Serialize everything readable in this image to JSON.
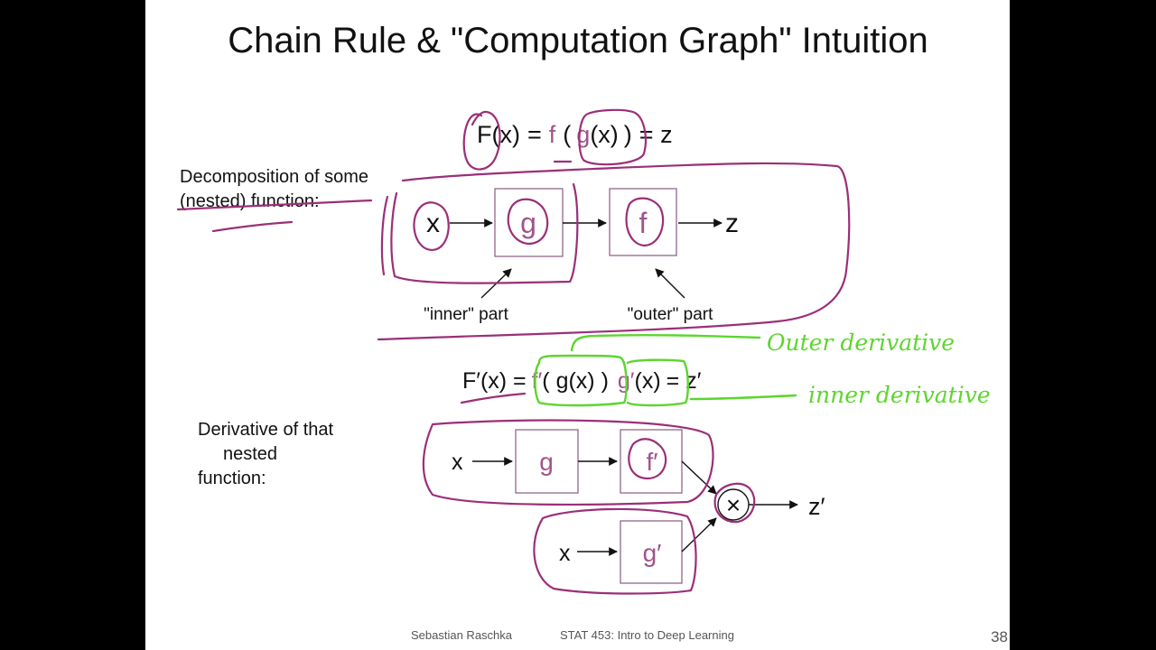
{
  "slide": {
    "title": "Chain Rule & \"Computation Graph\" Intuition",
    "page_number": "38",
    "footer_author": "Sebastian Raschka",
    "footer_course": "STAT 453: Intro to Deep Learning"
  },
  "top": {
    "eq": {
      "F": "F",
      "ox": "(x)",
      "eq1": "=",
      "f": "f",
      "po": "(",
      "g": "g",
      "gx": "(x)",
      "pc": ")",
      "eq2": "= z"
    },
    "label_line1": "Decomposition of some",
    "label_line2": "(nested) function:",
    "node_x": "x",
    "node_g": "g",
    "node_f": "f",
    "node_z": "z",
    "inner_label": "\"inner\" part",
    "outer_label": "\"outer\" part"
  },
  "bottom": {
    "eq": {
      "lhs": "F′(x) =",
      "fp": "f′",
      "mid": "( g(x) )",
      "gp": "g′",
      "gx": "(x)",
      "rhs": "= z′"
    },
    "label_line1": "Derivative of that",
    "label_line2": "nested",
    "label_line3": "function:",
    "row1_x": "x",
    "row1_g": "g",
    "row1_fp": "f′",
    "row2_x": "x",
    "row2_gp": "g′",
    "times": "×",
    "output": "z′"
  },
  "annotations": {
    "outer_derivative": "Outer derivative",
    "inner_derivative": "inner derivative"
  },
  "colors": {
    "highlight_purple": "#9b2f78",
    "highlight_green": "#5cd62e",
    "node_purple": "#a0548a"
  }
}
